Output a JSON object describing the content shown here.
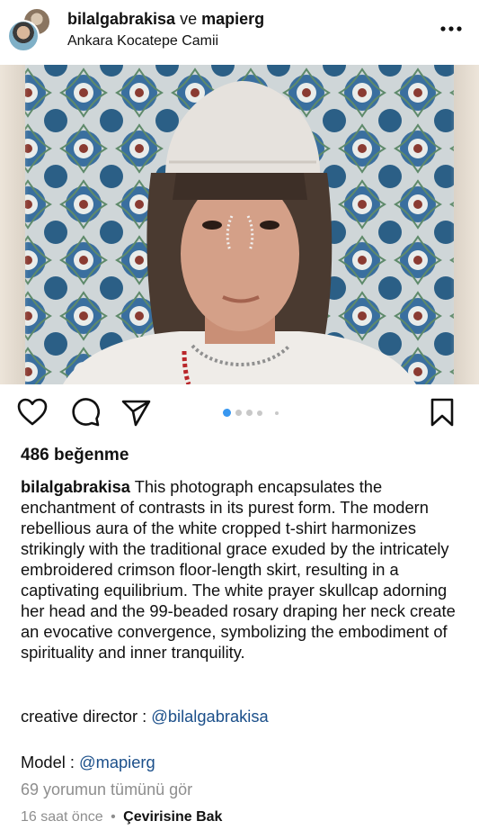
{
  "header": {
    "username": "bilalgabrakisa",
    "conjunction": "ve",
    "collaborator": "mapierg",
    "location": "Ankara Kocatepe Camii"
  },
  "icons": {
    "more": "more-horizontal-icon",
    "like": "heart-icon",
    "comment": "comment-icon",
    "share": "send-icon",
    "save": "bookmark-icon"
  },
  "carousel": {
    "total": 5,
    "active_index": 0,
    "accent": "#3897f0"
  },
  "post": {
    "likes": "486 beğenme",
    "caption_user": "bilalgabrakisa",
    "caption_text": "This photograph encapsulates the enchantment of contrasts in its purest form. The modern rebellious aura of the white cropped t-shirt harmonizes strikingly with the traditional grace exuded by the intricately embroidered crimson floor-length skirt, resulting in a captivating equilibrium. The white prayer skullcap adorning her head and the 99-beaded rosary draping her neck create an evocative convergence, symbolizing the embodiment of spirituality and inner tranquility.",
    "director_label": "creative director : ",
    "director_handle": "@bilalgabrakisa",
    "model_label": "Model : ",
    "model_handle": "@mapierg",
    "view_comments": "69 yorumun tümünü gör",
    "time": "16 saat önce",
    "separator": "•",
    "translate": "Çevirisine Bak"
  }
}
